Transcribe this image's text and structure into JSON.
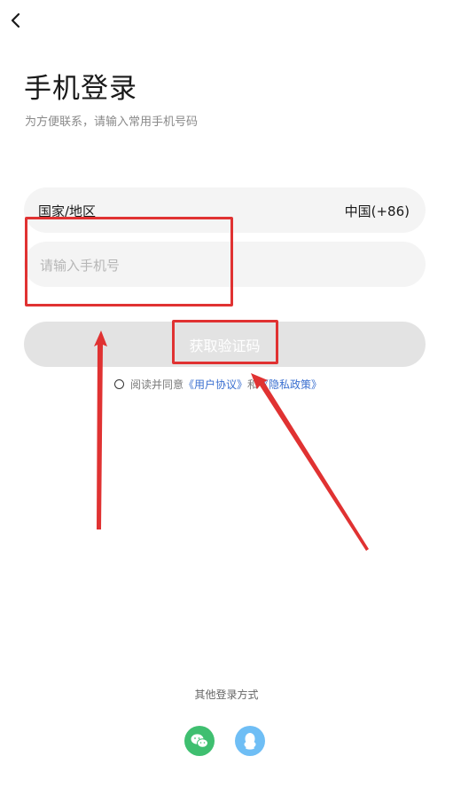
{
  "header": {
    "back_icon": "chevron-left-icon",
    "title": "手机登录",
    "subtitle": "为方便联系，请输入常用手机号码"
  },
  "form": {
    "region_label": "国家/地区",
    "region_value": "中国(+86)",
    "phone_placeholder": "请输入手机号",
    "phone_value": "",
    "get_code_label": "获取验证码"
  },
  "agreement": {
    "prefix": "阅读并同意",
    "user_agreement": "《用户协议》",
    "conjunction": "和",
    "privacy_policy": "《隐私政策》",
    "checked": false
  },
  "other_login": {
    "label": "其他登录方式",
    "options": [
      {
        "icon": "wechat-icon",
        "color": "#3fbf70"
      },
      {
        "icon": "qq-icon",
        "color": "#6fbef5"
      }
    ]
  },
  "annotation": {
    "color": "#e03232"
  }
}
